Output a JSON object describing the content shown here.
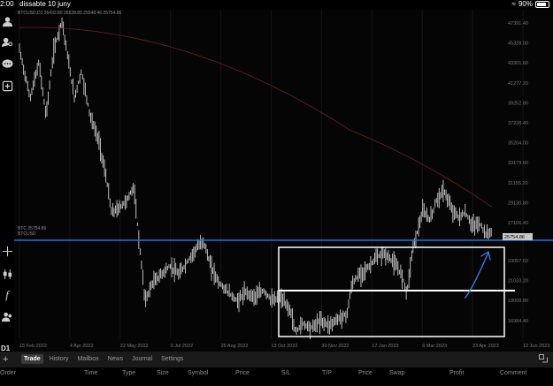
{
  "status_bar": {
    "time": "2:00",
    "date": "dissabte 10 juny",
    "battery": "90%"
  },
  "chart": {
    "symbol_line": "BTCUSD,D1  26432.80 26528.85 25548.46 25754.86",
    "level_label_1": "BTC 25754.86",
    "level_label_2": "BTCUSD",
    "current_price_label": "25754.86",
    "price_labels": [
      "47391.40",
      "45328.00",
      "43301.60",
      "41277.20",
      "39252.80",
      "37228.40",
      "35204.00",
      "33179.60",
      "31155.20",
      "29130.80",
      "27106.40",
      "23057.60",
      "21033.20",
      "19008.80",
      "16984.40"
    ],
    "date_labels": [
      "15 Feb 2022",
      "4 Apr 2022",
      "22 May 2022",
      "9 Jul 2022",
      "26 Aug 2022",
      "13 Oct 2022",
      "30 Nov 2022",
      "17 Jan 2023",
      "6 Mar 2023",
      "23 Apr 2023",
      "10 Jun 2023"
    ],
    "timeframe": "D1",
    "colors": {
      "candles": "#d0d0d0",
      "support_line": "#2a6fd6",
      "moving_average": "#6b2222",
      "box": "#ffffff",
      "arrow": "#3b7be6"
    }
  },
  "toolbar": {
    "icons": [
      "user-icon",
      "search-user-icon",
      "chat-icon",
      "add-chart-icon",
      "crosshair-icon",
      "candles-icon",
      "function-icon",
      "users-icon"
    ]
  },
  "bottom": {
    "tabs": [
      "Trade",
      "History",
      "Mailbox",
      "News",
      "Journal",
      "Settings"
    ],
    "active_tab": "Trade",
    "columns": [
      "Order",
      "Time",
      "Type",
      "Size",
      "Symbol",
      "Price",
      "S/L",
      "T/P",
      "Price",
      "Swap",
      "Profit",
      "Comment"
    ]
  }
}
